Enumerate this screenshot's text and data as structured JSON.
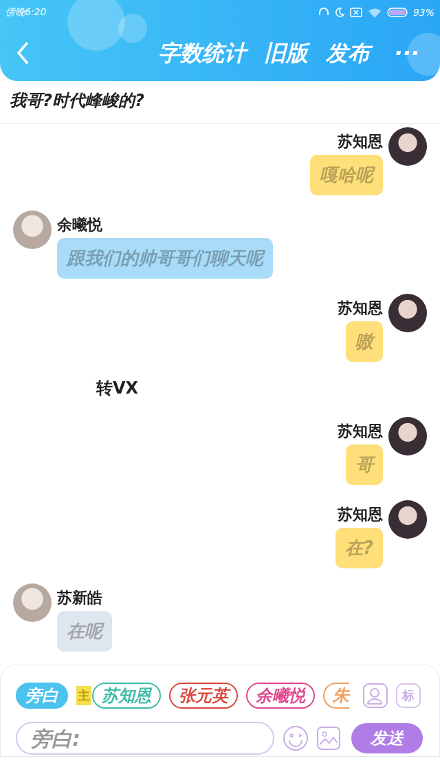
{
  "status_bar": {
    "time": "傍晚6:20",
    "battery": "93%"
  },
  "header": {
    "actions": [
      "字数统计",
      "旧版",
      "发布"
    ],
    "more": "···"
  },
  "chapter_title": "我哥?时代峰峻的?",
  "messages": [
    {
      "kind": "right",
      "name": "苏知恩",
      "text": "嘎哈呢",
      "color": "#ffdf7a"
    },
    {
      "kind": "left",
      "name": "余曦悦",
      "text": "跟我们的帅哥哥们聊天呢",
      "color": "#a8dcf8"
    },
    {
      "kind": "right",
      "name": "苏知恩",
      "text": "嗷",
      "color": "#ffdf7a"
    },
    {
      "kind": "narration",
      "text": "转VX"
    },
    {
      "kind": "right",
      "name": "苏知恩",
      "text": "哥",
      "color": "#ffdf7a"
    },
    {
      "kind": "right",
      "name": "苏知恩",
      "text": "在?",
      "color": "#ffdf7a"
    },
    {
      "kind": "left",
      "name": "苏新皓",
      "text": "在呢",
      "color": "#dfe6ef"
    }
  ],
  "roles": [
    {
      "label": "旁白",
      "color": "#4cc3ee",
      "selected": true
    },
    {
      "label": "苏知恩",
      "color": "#3dbba7",
      "selected": false,
      "badge": "主"
    },
    {
      "label": "张元英",
      "color": "#d9483f",
      "selected": false
    },
    {
      "label": "余曦悦",
      "color": "#e0478f",
      "selected": false
    },
    {
      "label": "朱",
      "color": "#f0a060",
      "selected": false
    }
  ],
  "role_button": "标",
  "input": {
    "placeholder": "旁白:"
  },
  "send_button": "发送"
}
